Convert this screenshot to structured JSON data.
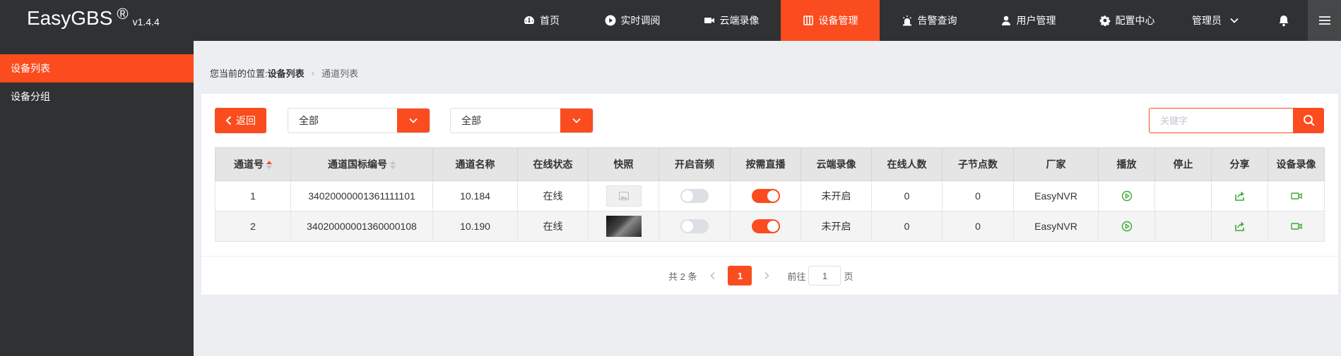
{
  "brand": {
    "name": "EasyGBS",
    "reg": "®",
    "version": "v1.4.4"
  },
  "nav": [
    {
      "label": "首页",
      "icon": "dashboard-icon"
    },
    {
      "label": "实时调阅",
      "icon": "play-circle-icon"
    },
    {
      "label": "云端录像",
      "icon": "video-camera-icon"
    },
    {
      "label": "设备管理",
      "icon": "device-icon",
      "active": true
    },
    {
      "label": "告警查询",
      "icon": "alarm-icon"
    },
    {
      "label": "用户管理",
      "icon": "user-icon"
    },
    {
      "label": "配置中心",
      "icon": "gear-icon"
    }
  ],
  "user": {
    "label": "管理员"
  },
  "sidebar": {
    "items": [
      {
        "label": "设备列表"
      },
      {
        "label": "设备分组"
      }
    ]
  },
  "breadcrumb": {
    "prefix": "您当前的位置:",
    "current": "设备列表",
    "sub": "通道列表"
  },
  "toolbar": {
    "back_label": "返回",
    "select1": "全部",
    "select2": "全部",
    "search_placeholder": "关键字"
  },
  "table": {
    "columns": [
      "通道号",
      "通道国标编号",
      "通道名称",
      "在线状态",
      "快照",
      "开启音频",
      "按需直播",
      "云端录像",
      "在线人数",
      "子节点数",
      "厂家",
      "播放",
      "停止",
      "分享",
      "设备录像"
    ],
    "rows": [
      {
        "no": "1",
        "gb_id": "34020000001361111101",
        "name": "10.184",
        "status": "在线",
        "audio": false,
        "on_demand": true,
        "cloud": "未开启",
        "online": "0",
        "children": "0",
        "vendor": "EasyNVR"
      },
      {
        "no": "2",
        "gb_id": "34020000001360000108",
        "name": "10.190",
        "status": "在线",
        "audio": false,
        "on_demand": true,
        "cloud": "未开启",
        "online": "0",
        "children": "0",
        "vendor": "EasyNVR"
      }
    ]
  },
  "pagination": {
    "total_text": "共 2 条",
    "current": "1",
    "goto_prefix": "前往",
    "goto_value": "1",
    "goto_suffix": "页"
  },
  "colors": {
    "accent": "#fb4c1f",
    "topbar": "#2f3133",
    "online": "#3aaa35"
  }
}
